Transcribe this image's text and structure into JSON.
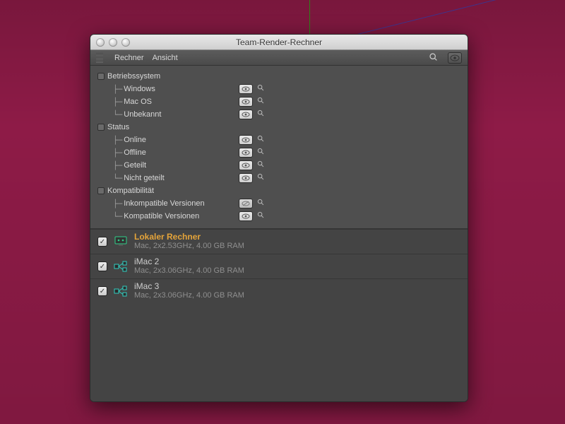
{
  "window": {
    "title": "Team-Render-Rechner",
    "menus": {
      "rechner": "Rechner",
      "ansicht": "Ansicht"
    }
  },
  "filters": {
    "os": {
      "label": "Betriebssystem",
      "items": [
        {
          "label": "Windows"
        },
        {
          "label": "Mac OS"
        },
        {
          "label": "Unbekannt"
        }
      ]
    },
    "status": {
      "label": "Status",
      "items": [
        {
          "label": "Online"
        },
        {
          "label": "Offline"
        },
        {
          "label": "Geteilt"
        },
        {
          "label": "Nicht geteilt"
        }
      ]
    },
    "compat": {
      "label": "Kompatibilität",
      "items": [
        {
          "label": "Inkompatible Versionen"
        },
        {
          "label": "Kompatible Versionen"
        }
      ]
    }
  },
  "machines": [
    {
      "name": "Lokaler Rechner",
      "detail": "Mac, 2x2.53GHz, 4.00 GB RAM",
      "local": true,
      "icon_color": "#2fd08a",
      "checked": true
    },
    {
      "name": "iMac 2",
      "detail": "Mac, 2x3.06GHz, 4.00 GB RAM",
      "local": false,
      "icon_color": "#2fd0c2",
      "checked": true
    },
    {
      "name": "iMac 3",
      "detail": "Mac, 2x3.06GHz, 4.00 GB RAM",
      "local": false,
      "icon_color": "#2fd0c2",
      "checked": true
    }
  ]
}
